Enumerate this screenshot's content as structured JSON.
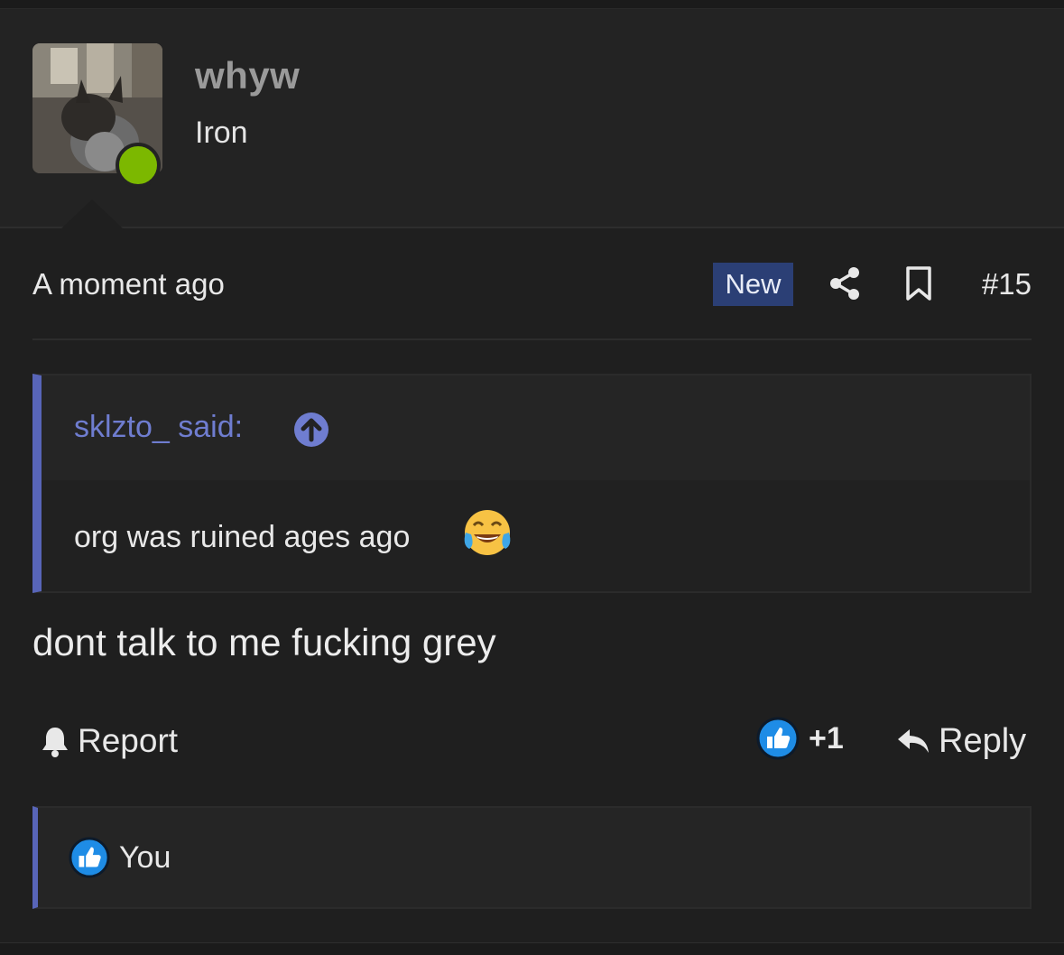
{
  "user": {
    "name": "whyw",
    "title": "Iron",
    "online_color": "#7cb800"
  },
  "post": {
    "timestamp": "A moment ago",
    "new_badge": "New",
    "number": "#15",
    "text": "dont talk to me fucking grey"
  },
  "quote": {
    "author": "sklzto_ said:",
    "text": "org was ruined ages ago",
    "emoji": "tears-of-joy-emoji"
  },
  "actions": {
    "report_label": "Report",
    "like_count": "+1",
    "reply_label": "Reply"
  },
  "reactions": {
    "users": "You"
  },
  "colors": {
    "accent": "#5865b8",
    "badge_bg": "#2b3f75",
    "like_blue": "#1e8ce6"
  }
}
